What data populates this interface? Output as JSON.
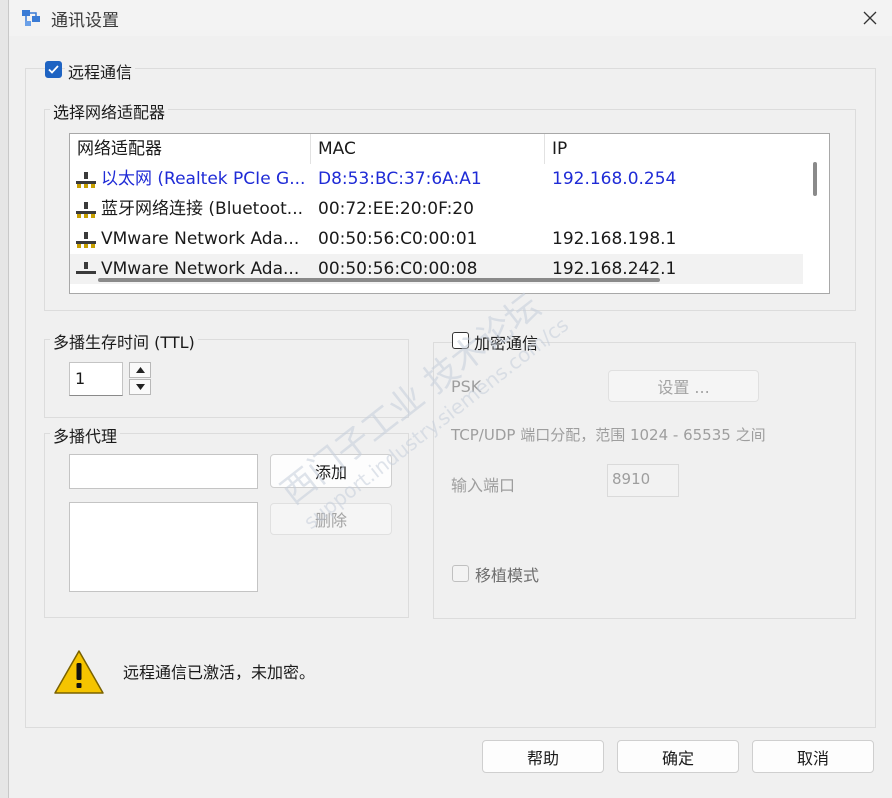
{
  "window": {
    "title": "通讯设置"
  },
  "remote": {
    "checkbox_label": "远程通信",
    "checked": true
  },
  "adapter_group": {
    "title": "选择网络适配器"
  },
  "adapter_table": {
    "columns": [
      "网络适配器",
      "MAC",
      "IP"
    ],
    "rows": [
      {
        "name": "以太网 (Realtek PCIe G...",
        "mac": "D8:53:BC:37:6A:A1",
        "ip": "192.168.0.254",
        "selected": true
      },
      {
        "name": "蓝牙网络连接 (Bluetoot...",
        "mac": "00:72:EE:20:0F:20",
        "ip": ""
      },
      {
        "name": "VMware Network Ada...",
        "mac": "00:50:56:C0:00:01",
        "ip": "192.168.198.1"
      },
      {
        "name": "VMware Network Ada...",
        "mac": "00:50:56:C0:00:08",
        "ip": "192.168.242.1"
      }
    ]
  },
  "ttl": {
    "label": "多播生存时间 (TTL)",
    "value": "1"
  },
  "proxy": {
    "label": "多播代理",
    "add_label": "添加",
    "delete_label": "删除"
  },
  "encryption": {
    "checkbox_label": "加密通信",
    "psk_label": "PSK",
    "settings_label": "设置 ...",
    "port_range_text": "TCP/UDP 端口分配，范围 1024 - 65535 之间",
    "input_port_label": "输入端口",
    "input_port_value": "8910",
    "legacy_label": "移植模式"
  },
  "status": {
    "text": "远程通信已激活，未加密。"
  },
  "buttons": {
    "help": "帮助",
    "ok": "确定",
    "cancel": "取消"
  },
  "watermark": {
    "line1": "西门子工业 技术论坛",
    "line2": "support.industry.siemens.com/cs"
  },
  "colors": {
    "accent": "#1e63c2",
    "selected_text": "#1f2bd6",
    "warning": "#f5c400"
  }
}
